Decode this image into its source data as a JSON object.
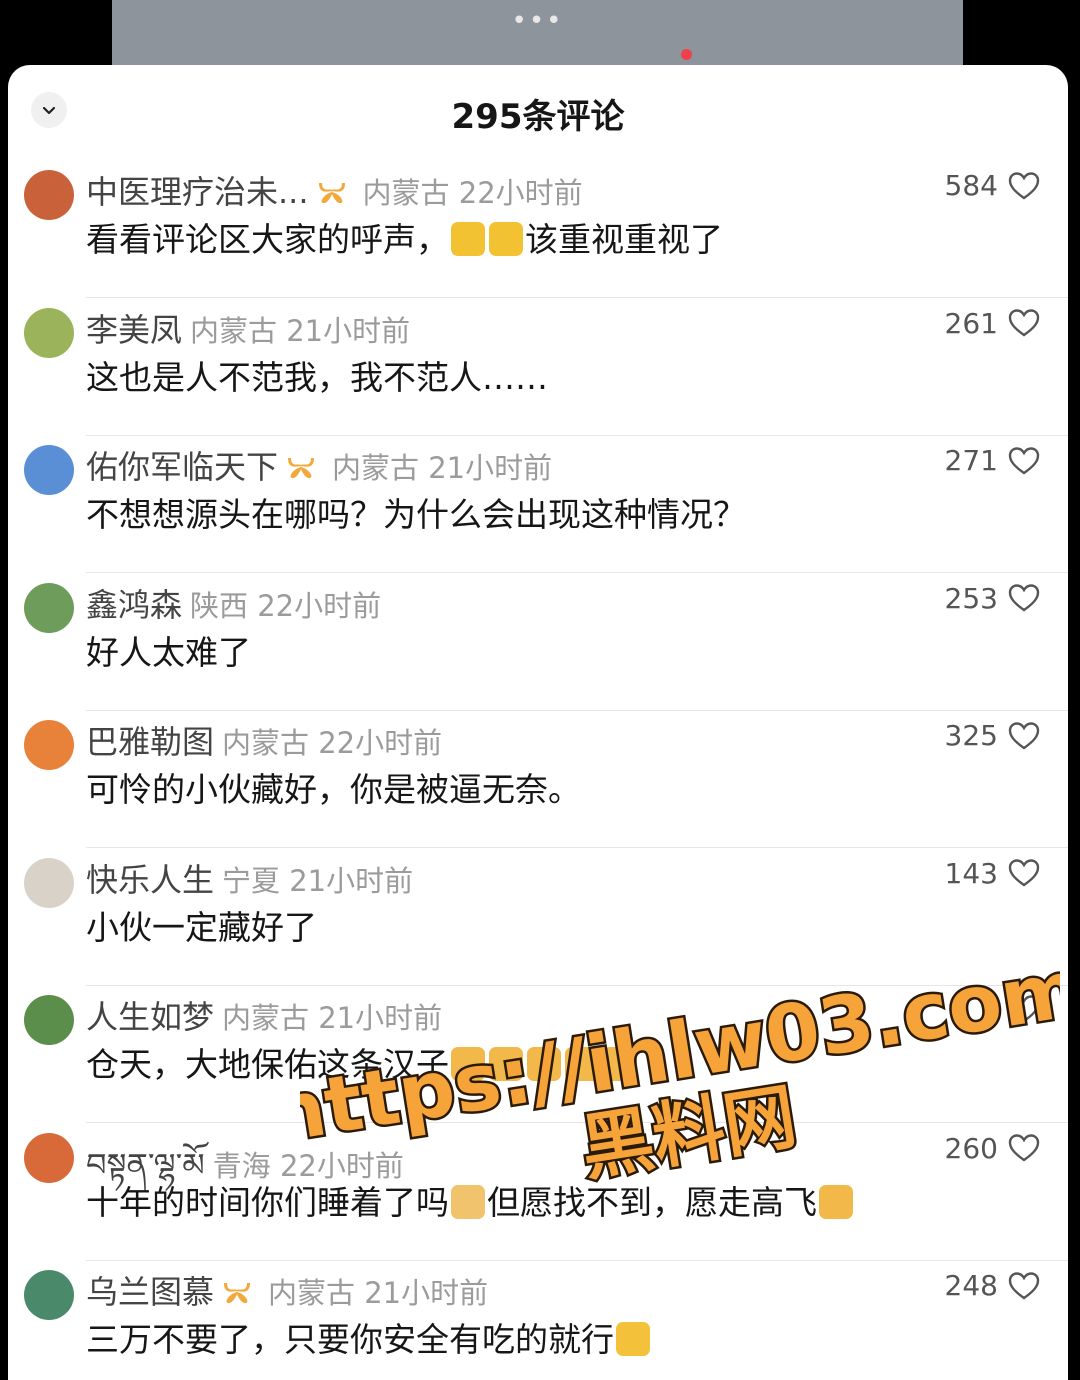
{
  "top_video": {
    "dots": "•••"
  },
  "header": {
    "title": "295条评论"
  },
  "comments": [
    {
      "user": "中医理疗治未...",
      "vip": true,
      "location": "内蒙古",
      "time": "22小时前",
      "likes": "584",
      "text_a": "看看评论区大家的呼声，",
      "text_b": "该重视重视了",
      "emojis": [
        "thumbs-up",
        "thumbs-up"
      ],
      "avatar_color": "#c9623a"
    },
    {
      "user": "李美凤",
      "vip": false,
      "location": "内蒙古",
      "time": "21小时前",
      "likes": "261",
      "text_a": "这也是人不范我，我不范人……",
      "avatar_color": "#9bb35a"
    },
    {
      "user": "佑你军临天下",
      "vip": true,
      "location": "内蒙古",
      "time": "21小时前",
      "likes": "271",
      "text_a": "不想想源头在哪吗？为什么会出现这种情况？",
      "avatar_color": "#5a8fd6"
    },
    {
      "user": "鑫鸿森",
      "vip": false,
      "location": "陕西",
      "time": "22小时前",
      "likes": "253",
      "text_a": "好人太难了",
      "avatar_color": "#6e9c5a"
    },
    {
      "user": "巴雅勒图",
      "vip": false,
      "location": "内蒙古",
      "time": "22小时前",
      "likes": "325",
      "text_a": "可怜的小伙藏好，你是被逼无奈。",
      "avatar_color": "#e8823a"
    },
    {
      "user": "快乐人生",
      "vip": false,
      "location": "宁夏",
      "time": "21小时前",
      "likes": "143",
      "text_a": "小伙一定藏好了",
      "avatar_color": "#d8d2c8"
    },
    {
      "user": "人生如梦",
      "vip": false,
      "location": "内蒙古",
      "time": "21小时前",
      "likes": "",
      "text_a": "仓天，大地保佑这条汉子",
      "emojis": [
        "pray",
        "pray",
        "pray",
        "pray",
        "pray"
      ],
      "avatar_color": "#5a8e4a"
    },
    {
      "user": "བསྟན་ལྷ་མོ",
      "vip": false,
      "location": "青海",
      "time": "22小时前",
      "likes": "260",
      "text_a": "十年的时间你们睡着了吗",
      "text_b": "但愿找不到，愿走高飞",
      "emojis": [
        "cat",
        "pray"
      ],
      "avatar_color": "#d86a3a"
    },
    {
      "user": "乌兰图慕",
      "vip": true,
      "location": "内蒙古",
      "time": "21小时前",
      "likes": "248",
      "text_a": "三万不要了，只要你安全有吃的就行",
      "emojis": [
        "crying"
      ],
      "avatar_color": "#4a8a6a"
    }
  ],
  "watermark": {
    "line1": "https://ihlw03.com",
    "line2": "黑料网"
  },
  "colors": {
    "vip_badge": "#f2a93b",
    "like_heart": "#555555",
    "watermark_fill": "#f6a43a"
  }
}
